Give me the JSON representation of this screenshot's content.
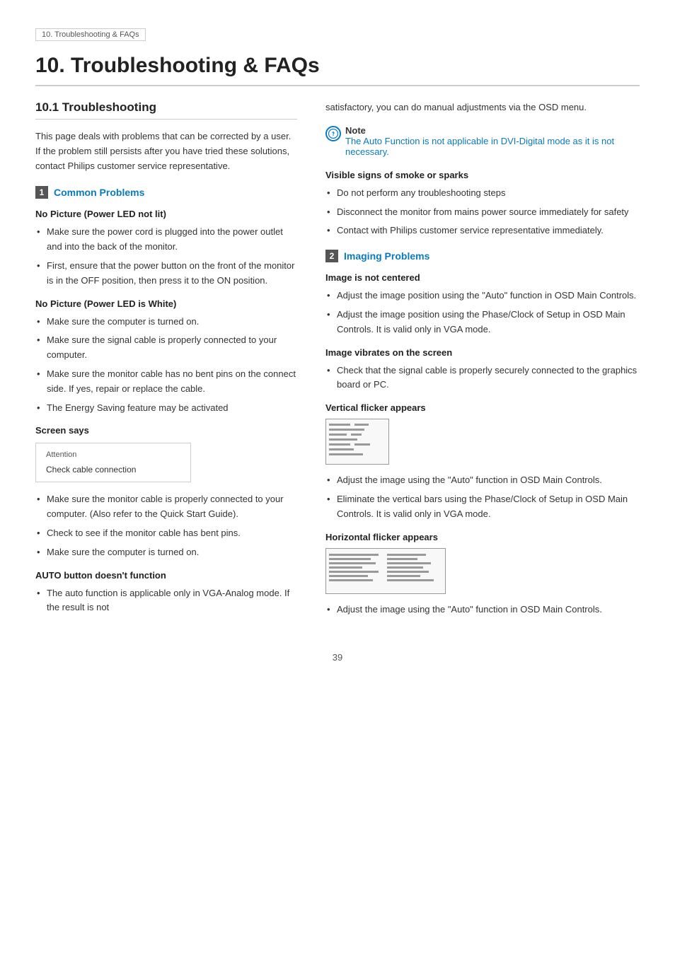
{
  "breadcrumb": "10. Troubleshooting & FAQs",
  "main_title": "10. Troubleshooting & FAQs",
  "section_10_1_title": "10.1 Troubleshooting",
  "intro_text": "This page deals with problems that can be corrected by a user. If the problem still persists after you have tried these solutions, contact Philips customer service representative.",
  "left": {
    "common_problems_badge": "1",
    "common_problems_label": "Common Problems",
    "no_picture_led_not_lit_heading": "No Picture (Power LED not lit)",
    "no_picture_led_not_lit_bullets": [
      "Make sure the power cord is plugged into the power outlet and into the back of the monitor.",
      "First, ensure that the power button on the front of the monitor is in the OFF position, then press it to the ON position."
    ],
    "no_picture_led_white_heading": "No Picture (Power LED is White)",
    "no_picture_led_white_bullets": [
      "Make sure the computer is turned on.",
      "Make sure the signal cable is properly connected to your computer.",
      "Make sure the monitor cable has no bent pins on the connect side. If yes, repair or replace the cable.",
      "The Energy Saving feature may be activated"
    ],
    "screen_says_heading": "Screen says",
    "screen_says_box": {
      "attention_label": "Attention",
      "message": "Check cable connection"
    },
    "screen_says_bullets": [
      "Make sure the monitor cable is properly connected to your computer. (Also refer to the Quick Start Guide).",
      "Check to see if the monitor cable has bent pins.",
      "Make sure the computer is turned on."
    ],
    "auto_button_heading": "AUTO button doesn't function",
    "auto_button_bullets": [
      "The auto function is applicable only in VGA-Analog mode. If the result is not"
    ]
  },
  "right": {
    "auto_continued_text": "satisfactory, you can do manual adjustments via the OSD menu.",
    "note_title": "Note",
    "note_text": "The Auto Function is not applicable in DVI-Digital mode as it is not necessary.",
    "visible_signs_heading": "Visible signs of smoke or sparks",
    "visible_signs_bullets": [
      "Do not perform any troubleshooting steps",
      "Disconnect the monitor from mains power source immediately for safety",
      "Contact with Philips customer service representative immediately."
    ],
    "imaging_problems_badge": "2",
    "imaging_problems_label": "Imaging Problems",
    "image_not_centered_heading": "Image is not centered",
    "image_not_centered_bullets": [
      "Adjust the image position using the \"Auto\" function in OSD Main Controls.",
      "Adjust the image position using the Phase/Clock of Setup in OSD Main Controls. It is valid only in VGA mode."
    ],
    "image_vibrates_heading": "Image vibrates on the screen",
    "image_vibrates_bullets": [
      "Check that the signal cable is properly securely connected to the graphics board or PC."
    ],
    "vertical_flicker_heading": "Vertical flicker appears",
    "vertical_flicker_bullets": [
      "Adjust the image using the \"Auto\" function in OSD Main Controls.",
      "Eliminate the vertical bars using the Phase/Clock of Setup in OSD Main Controls. It is valid only in VGA mode."
    ],
    "horizontal_flicker_heading": "Horizontal flicker appears",
    "horizontal_flicker_bullets": [
      "Adjust the image using the \"Auto\" function in OSD Main Controls."
    ]
  },
  "page_number": "39"
}
